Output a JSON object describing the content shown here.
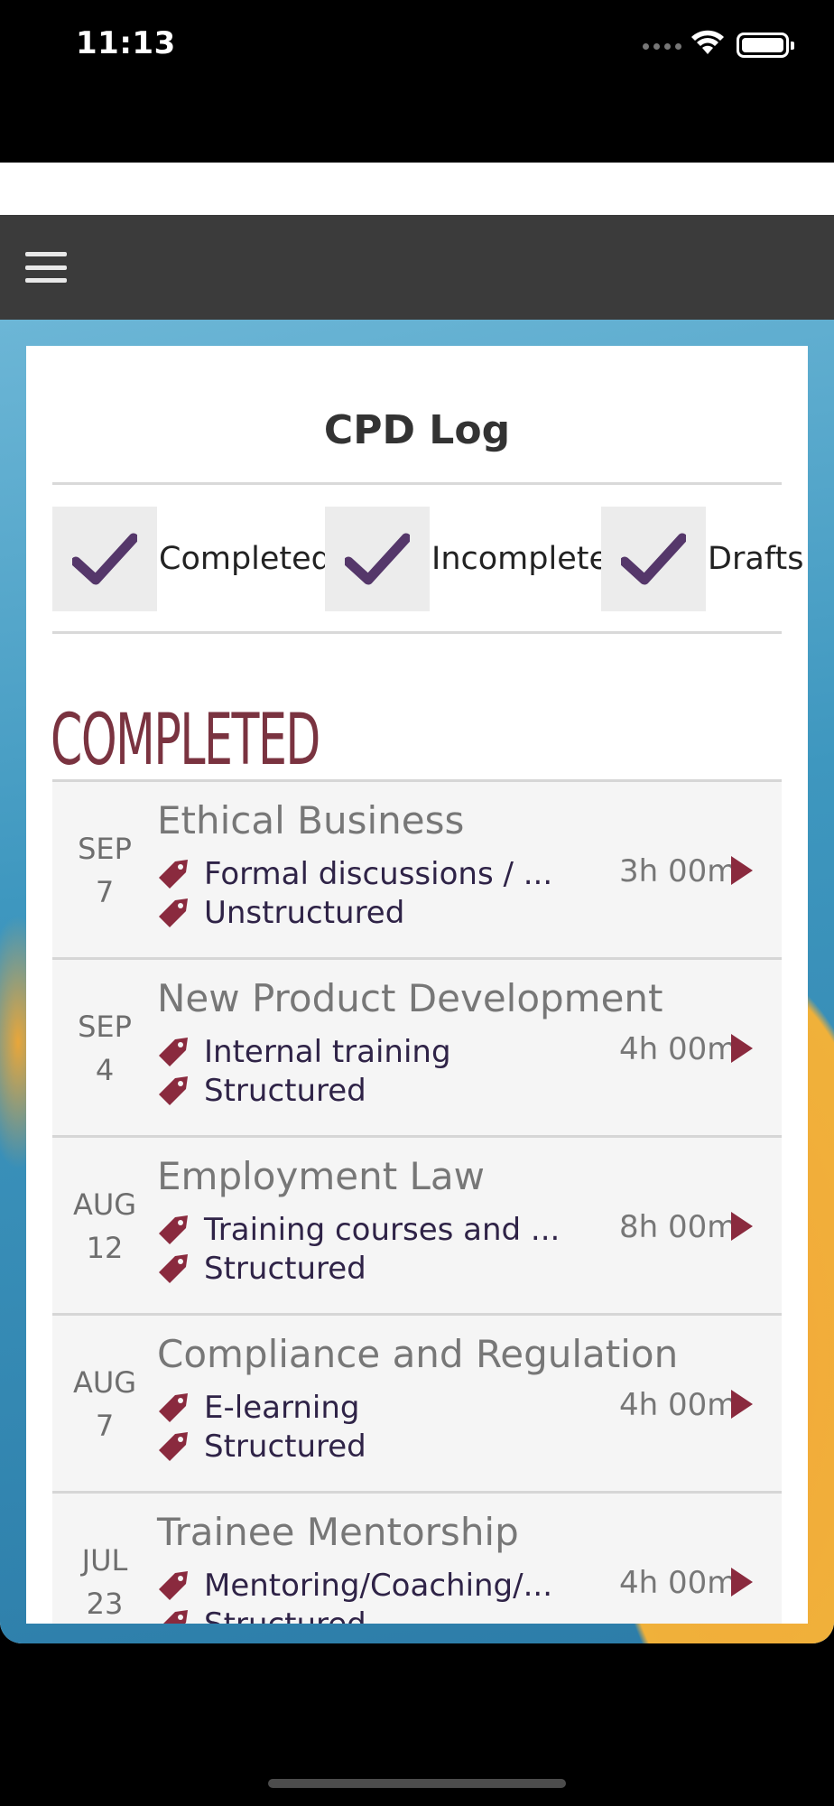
{
  "status_bar": {
    "time": "11:13"
  },
  "page": {
    "title": "CPD Log"
  },
  "filters": [
    {
      "label": "Completed",
      "checked": true
    },
    {
      "label": "Incomplete",
      "checked": true
    },
    {
      "label": "Drafts",
      "checked": true
    }
  ],
  "section": {
    "title": "COMPLETED"
  },
  "entries": [
    {
      "month": "SEP",
      "day": "7",
      "title": "Ethical Business",
      "category": "Formal discussions / ...",
      "type": "Unstructured",
      "duration": "3h 00m"
    },
    {
      "month": "SEP",
      "day": "4",
      "title": "New Product Development",
      "category": "Internal training",
      "type": "Structured",
      "duration": "4h 00m"
    },
    {
      "month": "AUG",
      "day": "12",
      "title": "Employment Law",
      "category": "Training courses and ...",
      "type": "Structured",
      "duration": "8h 00m"
    },
    {
      "month": "AUG",
      "day": "7",
      "title": "Compliance and Regulation",
      "category": "E-learning",
      "type": "Structured",
      "duration": "4h 00m"
    },
    {
      "month": "JUL",
      "day": "23",
      "title": "Trainee Mentorship",
      "category": "Mentoring/Coaching/...",
      "type": "Structured",
      "duration": "4h 00m"
    }
  ],
  "colors": {
    "accent": "#55376a",
    "tag": "#8a2a3e",
    "section_title": "#7a3340",
    "navbar": "#3b3b3b"
  }
}
